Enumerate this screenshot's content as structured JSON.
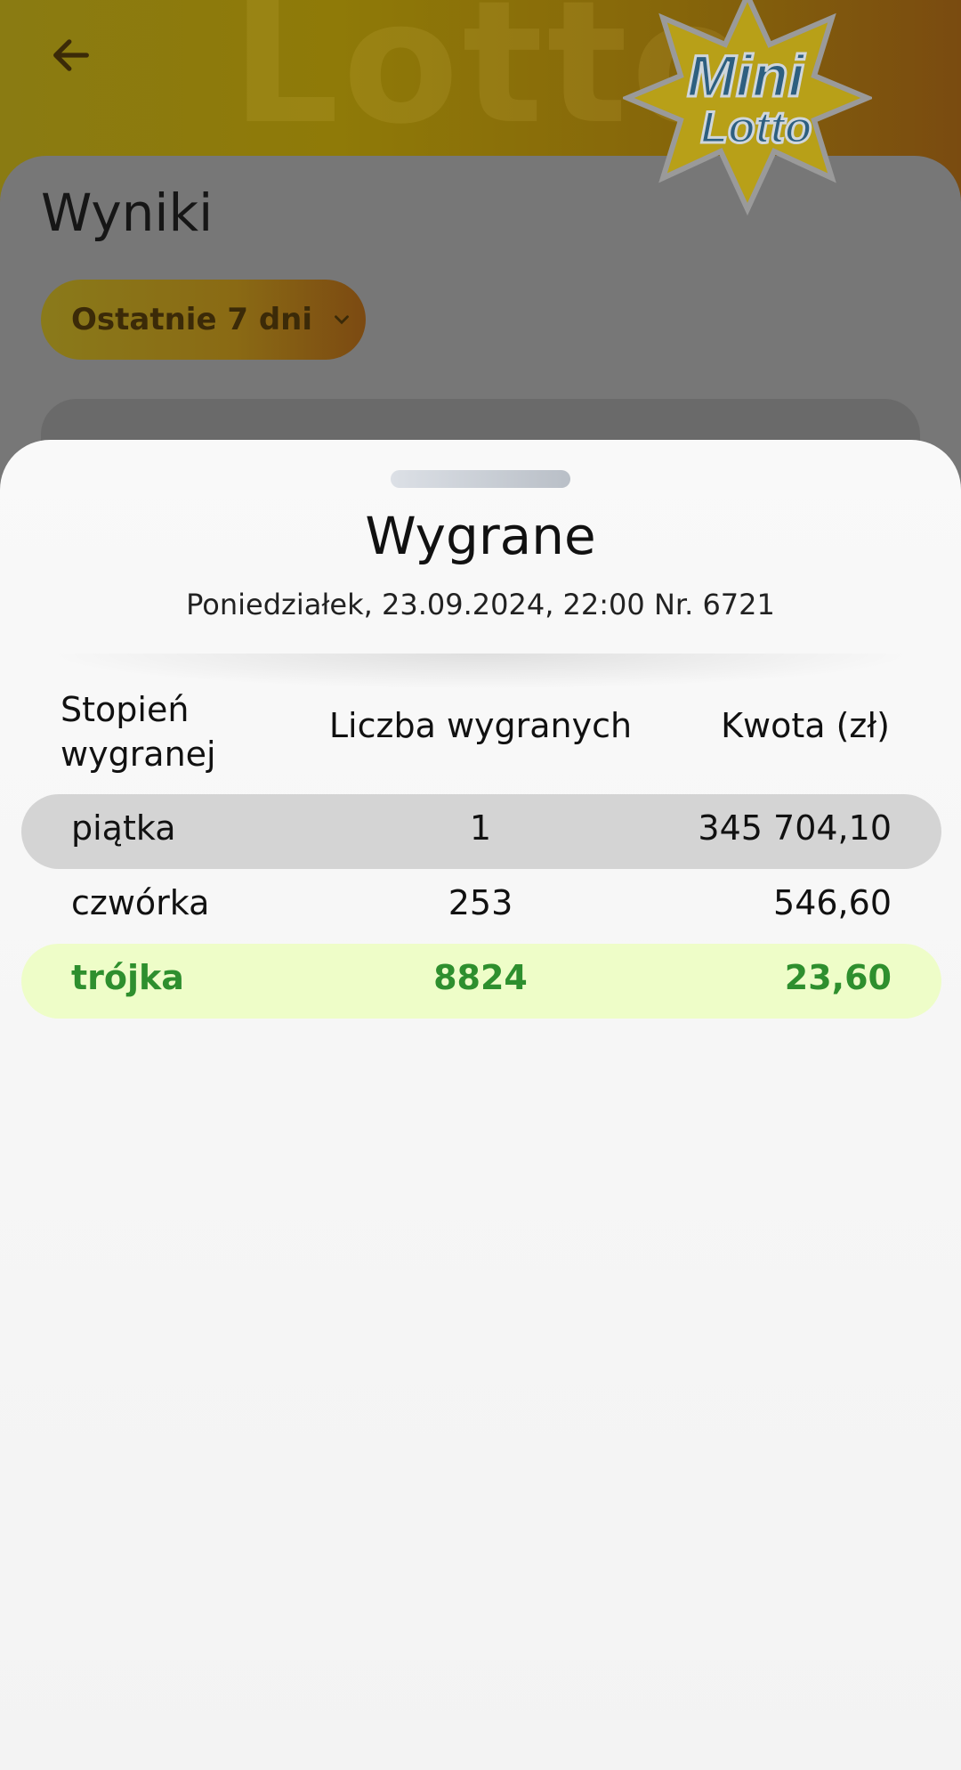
{
  "header": {
    "back_icon": "arrow-left-icon",
    "logo": {
      "text_line1": "Mini",
      "text_line2": "Lotto"
    },
    "watermark": "Lotto"
  },
  "page": {
    "title": "Wyniki",
    "filter_label": "Ostatnie 7 dni",
    "filter_icon": "chevron-down-icon"
  },
  "sheet": {
    "title": "Wygrane",
    "subtitle": "Poniedziałek, 23.09.2024, 22:00 Nr. 6721",
    "table": {
      "headers": [
        "Stopień wygranej",
        "Liczba wygranych",
        "Kwota (zł)"
      ],
      "rows": [
        {
          "grade": "piątka",
          "count": "1",
          "amount": "345 704,10"
        },
        {
          "grade": "czwórka",
          "count": "253",
          "amount": "546,60"
        },
        {
          "grade": "trójka",
          "count": "8824",
          "amount": "23,60"
        }
      ]
    }
  },
  "colors": {
    "highlight_row": "#eefdc8",
    "highlight_text": "#2e8f2e",
    "top_row": "#d4d4d4"
  }
}
